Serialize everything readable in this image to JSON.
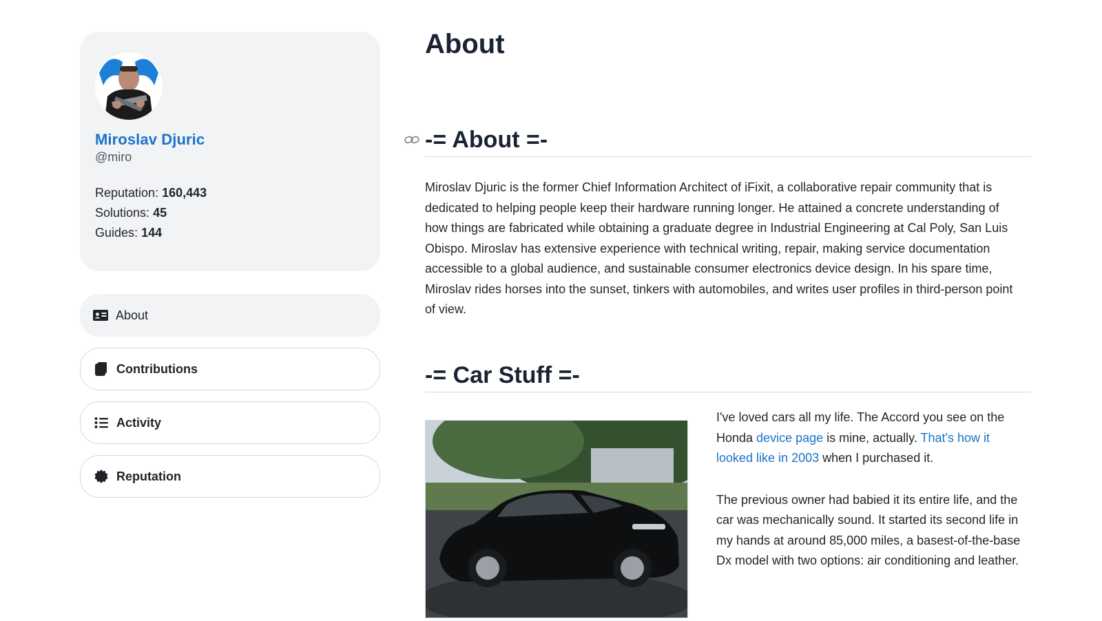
{
  "profile": {
    "name": "Miroslav Djuric",
    "handle": "@miro",
    "stats": [
      {
        "label": "Reputation:",
        "value": "160,443"
      },
      {
        "label": "Solutions:",
        "value": "45"
      },
      {
        "label": "Guides:",
        "value": "144"
      }
    ]
  },
  "nav": {
    "items": [
      {
        "label": "About",
        "icon": "id-card-icon"
      },
      {
        "label": "Contributions",
        "icon": "documents-icon"
      },
      {
        "label": "Activity",
        "icon": "list-icon"
      },
      {
        "label": "Reputation",
        "icon": "badge-icon"
      }
    ]
  },
  "main": {
    "title": "About",
    "sections": [
      {
        "heading": "-= About =-",
        "body": "Miroslav Djuric is the former Chief Information Architect of iFixit, a collaborative repair community that is dedicated to helping people keep their hardware running longer. He attained a concrete understanding of how things are fabricated while obtaining a graduate degree in Industrial Engineering at Cal Poly, San Luis Obispo. Miroslav has extensive experience with technical writing, repair, making service documentation accessible to a global audience, and sustainable consumer electronics device design. In his spare time, Miroslav rides horses into the sunset, tinkers with automobiles, and writes user profiles in third-person point of view."
      },
      {
        "heading": "-= Car Stuff =-",
        "p1": {
          "t1": "I've loved cars all my life. The Accord you see on the Honda ",
          "link1": "device page",
          "t2": " is mine, actually. ",
          "link2": "That's how it looked like in 2003",
          "t3": " when I purchased it."
        },
        "p2": "The previous owner had babied it its entire life, and the car was mechanically sound. It started its second life in my hands at around 85,000 miles, a basest-of-the-base Dx model with two options: air conditioning and leather."
      }
    ]
  },
  "colors": {
    "accent": "#1a73c8",
    "card_bg": "#f2f3f5",
    "border": "#d4d7dc"
  }
}
